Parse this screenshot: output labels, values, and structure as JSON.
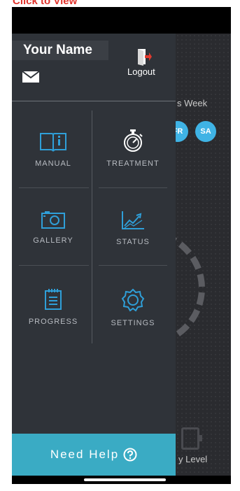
{
  "caption": "Click to View",
  "background": {
    "week_label": "s Week",
    "days": [
      "FR",
      "SA"
    ],
    "level_label": "y Level"
  },
  "drawer": {
    "user_name": "Your Name",
    "logout_label": "Logout",
    "menu": [
      {
        "label": "MANUAL",
        "icon": "manual-book-icon"
      },
      {
        "label": "TREATMENT",
        "icon": "stopwatch-icon"
      },
      {
        "label": "GALLERY",
        "icon": "camera-icon"
      },
      {
        "label": "STATUS",
        "icon": "chart-icon"
      },
      {
        "label": "PROGRESS",
        "icon": "clipboard-icon"
      },
      {
        "label": "SETTINGS",
        "icon": "gear-icon"
      }
    ],
    "help_label": "Need Help"
  },
  "colors": {
    "accent": "#3aabc4",
    "icon_blue": "#2f9fd8",
    "caption_red": "#e0322b",
    "logout_red": "#e23a2e"
  }
}
